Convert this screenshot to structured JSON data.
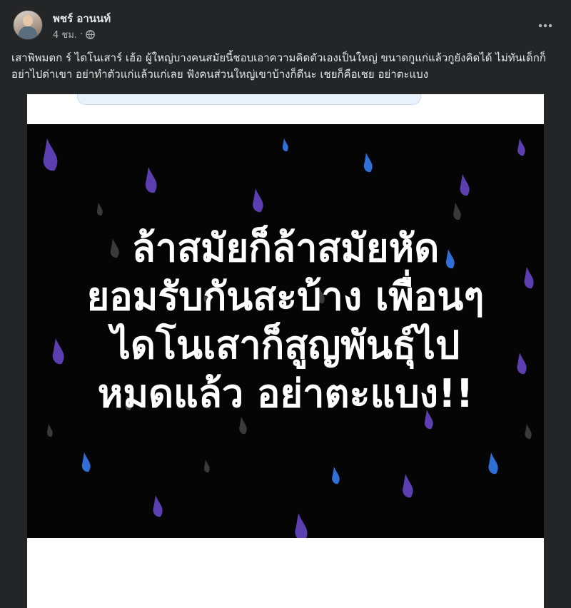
{
  "post": {
    "author": "พชร์ อานนท์",
    "time": "4 ชม.",
    "separator": "·",
    "caption": "เสาพิพมตก ร์ ไดโนเสาร์ เฮ้อ ผู้ใหญ่บางคนสมัยนี้ชอบเอาความคิดตัวเองเป็นใหญ่ ขนาดกูแก่แล้วกูยังคิดได้ ไม่ทันเด็กก็อย่าไปด่าเขา อย่าทำตัวแก่แล้วแก่เลย ฟังคนส่วนใหญ่เขาบ้างก็ดีนะ เชยก็คือเชย อย่าตะแบง",
    "more_icon": "more-horizontal-icon",
    "privacy_icon": "globe-icon"
  },
  "image": {
    "lines": [
      "ล้าสมัยก็ล้าสมัยหัด",
      "ยอมรับกันสะบ้าง เพื่อนๆ",
      "ไดโนเสาก็สูญพันธุ์ไป",
      "หมดแล้ว อย่าตะแบง!!"
    ],
    "colors": {
      "background": "#050505",
      "text": "#ffffff",
      "drop_purple": "#5b3fb0",
      "drop_blue": "#2f6fd6",
      "drop_grey": "#3a3a3a"
    }
  }
}
